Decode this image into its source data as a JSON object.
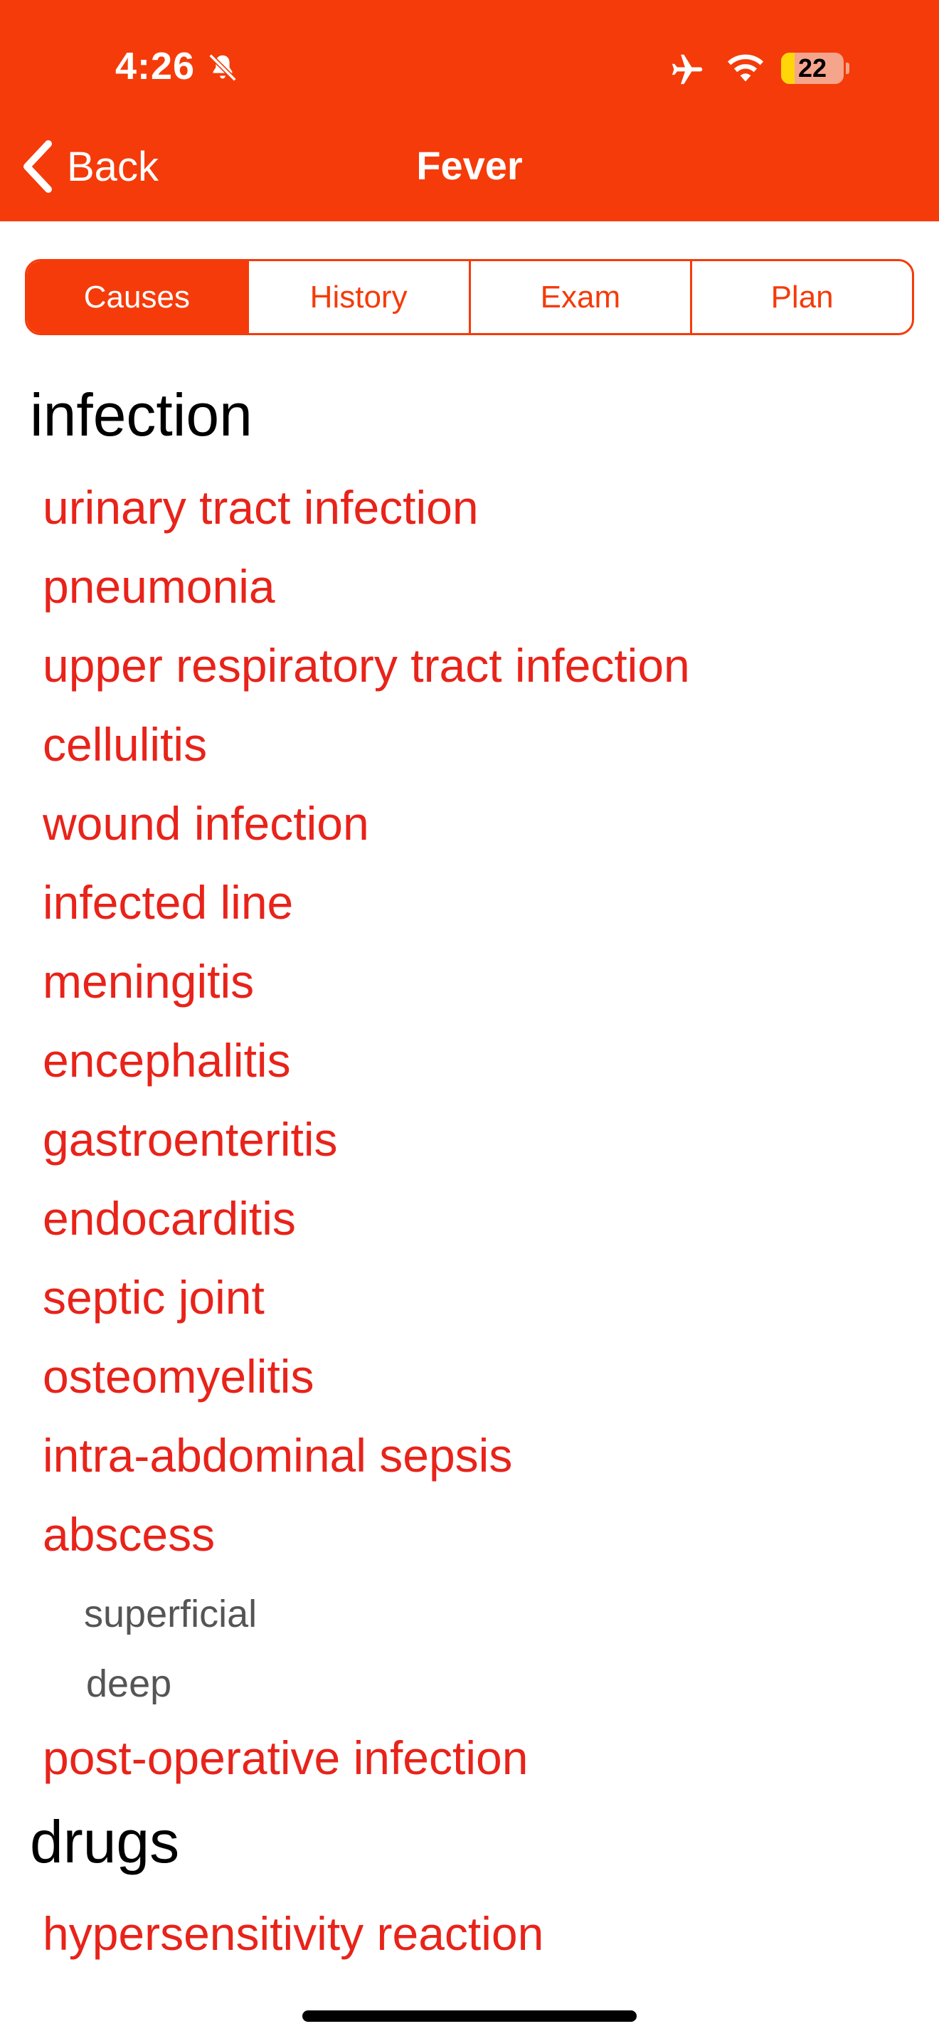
{
  "status_bar": {
    "time": "4:26",
    "battery": "22",
    "battery_level_percent": 22,
    "icons": [
      "bell-slash-icon",
      "airplane-icon",
      "wifi-icon",
      "battery-icon"
    ]
  },
  "nav": {
    "back_label": "Back",
    "title": "Fever"
  },
  "tabs": [
    {
      "label": "Causes",
      "active": true
    },
    {
      "label": "History",
      "active": false
    },
    {
      "label": "Exam",
      "active": false
    },
    {
      "label": "Plan",
      "active": false
    }
  ],
  "sections": {
    "infection": {
      "heading": "infection",
      "items": [
        "urinary tract infection",
        "pneumonia",
        "upper respiratory tract infection",
        "cellulitis",
        "wound infection",
        "infected line",
        "meningitis",
        "encephalitis",
        "gastroenteritis",
        "endocarditis",
        "septic joint",
        "osteomyelitis",
        "intra-abdominal sepsis",
        "abscess"
      ],
      "abscess_subitems": [
        "superficial",
        "deep"
      ],
      "last_item": "post-operative infection"
    },
    "drugs": {
      "heading": "drugs",
      "items": [
        "hypersensitivity reaction"
      ]
    }
  },
  "colors": {
    "accent": "#f53b0a",
    "link": "#e8231a",
    "subtext": "#555555"
  }
}
